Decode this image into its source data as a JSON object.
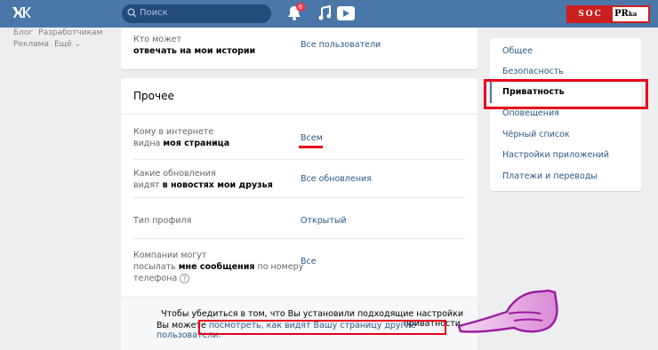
{
  "topbar": {
    "search_placeholder": "Поиск",
    "notifications_count": "6",
    "brand_left": "SOC",
    "brand_right": "PR",
    "brand_suffix": "ka"
  },
  "left_links": [
    "Блог",
    "Разработчикам",
    "Реклама",
    "Ещё ⌄"
  ],
  "top_card": {
    "label_line1": "Кто может",
    "label_line2": "отвечать на мои истории",
    "value": "Все пользователи"
  },
  "section": {
    "title": "Прочее",
    "rows": [
      {
        "l1": "Кому в интернете",
        "l2_plain": "видна ",
        "l2_bold": "моя страница",
        "value": "Всем"
      },
      {
        "l1": "Какие обновления",
        "l2_plain": "видят ",
        "l2_bold": "в новостях мои друзья",
        "value": "Все обновления"
      },
      {
        "l1": "Тип профиля",
        "value": "Открытый"
      },
      {
        "l1": "Компании могут",
        "l2_plain": "посылать ",
        "l2_bold": "мне сообщения",
        "l2_tail": " по номеру",
        "l3": "телефона",
        "value": "Все"
      }
    ]
  },
  "footer_note": {
    "line1": "Чтобы убедиться в том, что Вы установили подходящие настройки приватности,",
    "line2_prefix": "Вы можете ",
    "link": "посмотреть, как видят Вашу страницу другие пользователи."
  },
  "menu": {
    "items": [
      "Общее",
      "Безопасность",
      "Приватность",
      "Оповещения",
      "Чёрный список",
      "Настройки приложений",
      "Платежи и переводы"
    ],
    "active_index": 2
  },
  "colors": {
    "header": "#4a76a8",
    "link": "#2a5885",
    "highlight": "#e8001c"
  }
}
